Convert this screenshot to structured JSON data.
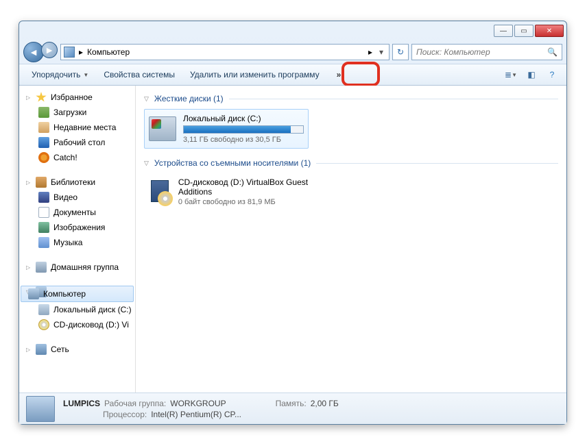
{
  "address": {
    "location": "Компьютер",
    "arrow": "▸"
  },
  "search": {
    "placeholder": "Поиск: Компьютер"
  },
  "toolbar": {
    "organize": "Упорядочить",
    "sysprops": "Свойства системы",
    "uninstall": "Удалить или изменить программу",
    "overflow": "»"
  },
  "sidebar": {
    "favorites": {
      "label": "Избранное",
      "items": [
        "Загрузки",
        "Недавние места",
        "Рабочий стол",
        "Catch!"
      ]
    },
    "libraries": {
      "label": "Библиотеки",
      "items": [
        "Видео",
        "Документы",
        "Изображения",
        "Музыка"
      ]
    },
    "homegroup": "Домашняя группа",
    "computer": {
      "label": "Компьютер",
      "items": [
        "Локальный диск (C:)",
        "CD-дисковод (D:) Vi"
      ]
    },
    "network": "Сеть"
  },
  "sections": {
    "hdd": {
      "title": "Жесткие диски (1)",
      "drive": {
        "name": "Локальный диск (C:)",
        "free": "3,11 ГБ свободно из 30,5 ГБ"
      }
    },
    "removable": {
      "title": "Устройства со съемными носителями (1)",
      "drive": {
        "name": "CD-дисковод (D:) VirtualBox Guest Additions",
        "free": "0 байт свободно из 81,9 МБ"
      }
    }
  },
  "status": {
    "name": "LUMPICS",
    "workgroup_label": "Рабочая группа:",
    "workgroup": "WORKGROUP",
    "cpu_label": "Процессор:",
    "cpu": "Intel(R) Pentium(R) CP...",
    "mem_label": "Память:",
    "mem": "2,00 ГБ"
  }
}
